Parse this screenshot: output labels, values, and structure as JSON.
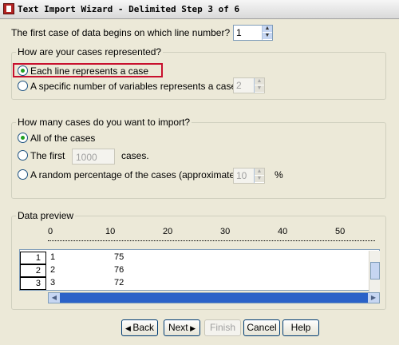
{
  "window": {
    "title": "Text Import Wizard - Delimited Step 3 of 6"
  },
  "first_case": {
    "label": "The first case of data begins on which line number?",
    "value": "1"
  },
  "cases_represented": {
    "legend": "How are your cases represented?",
    "option1": "Each line represents a case",
    "option2": "A specific number of variables represents a case:",
    "option2_value": "2",
    "selected": "option1"
  },
  "import_count": {
    "legend": "How many cases do you want to import?",
    "option_all": "All of the cases",
    "option_first_pre": "The first",
    "option_first_value": "1000",
    "option_first_post": "cases.",
    "option_random": "A random percentage of the cases (approximate):",
    "option_random_value": "10",
    "option_random_unit": "%",
    "selected": "all"
  },
  "preview": {
    "legend": "Data preview",
    "ruler_ticks": [
      "0",
      "10",
      "20",
      "30",
      "40",
      "50"
    ],
    "rows": [
      {
        "num": "1",
        "col1": "1",
        "col2": "75"
      },
      {
        "num": "2",
        "col1": "2",
        "col2": "76"
      },
      {
        "num": "3",
        "col1": "3",
        "col2": "72"
      }
    ]
  },
  "buttons": {
    "back": "Back",
    "next": "Next",
    "finish": "Finish",
    "cancel": "Cancel",
    "help": "Help"
  },
  "colors": {
    "highlight": "#c8102e",
    "radio_selected": "#21a121"
  }
}
